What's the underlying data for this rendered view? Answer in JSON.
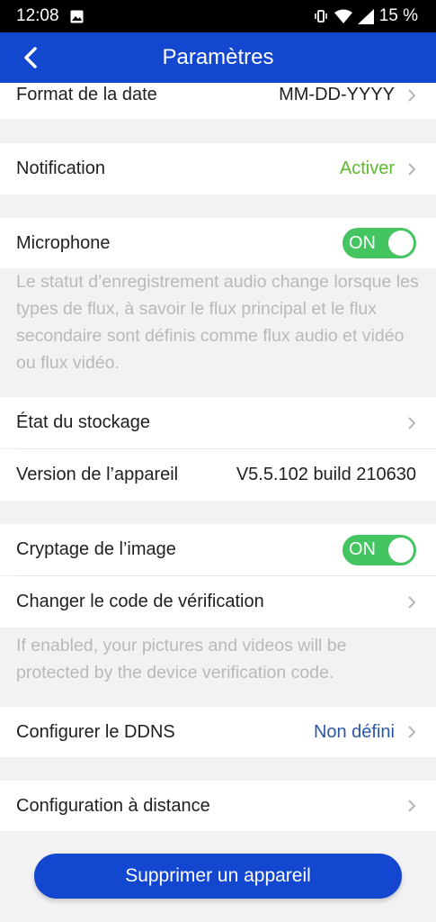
{
  "status_bar": {
    "time": "12:08",
    "battery": "15 %"
  },
  "nav": {
    "title": "Paramètres"
  },
  "rows": {
    "date_format": {
      "label": "Format de la date",
      "value": "MM-DD-YYYY"
    },
    "notification": {
      "label": "Notification",
      "value": "Activer"
    },
    "microphone": {
      "label": "Microphone",
      "toggle": "ON"
    },
    "storage": {
      "label": "État du stockage"
    },
    "device_version": {
      "label": "Version de l’appareil",
      "value": "V5.5.102 build 210630"
    },
    "image_encryption": {
      "label": "Cryptage de l’image",
      "toggle": "ON"
    },
    "verification_code": {
      "label": "Changer le code de vérification"
    },
    "ddns": {
      "label": "Configurer le DDNS",
      "value": "Non défini"
    },
    "remote_config": {
      "label": "Configuration à distance"
    }
  },
  "notes": {
    "microphone": "Le statut d’enregistrement audio change lorsque les types de flux, à savoir le flux principal et le flux secondaire sont définis comme flux audio et vidéo ou flux vidéo.",
    "encryption": "If enabled, your pictures and videos will be protected by the device verification code."
  },
  "actions": {
    "delete": "Supprimer un appareil"
  },
  "colors": {
    "primary": "#1447d0",
    "toggle_on": "#45c561",
    "accent_green": "#5cba2d",
    "link_blue": "#2b58a4"
  }
}
